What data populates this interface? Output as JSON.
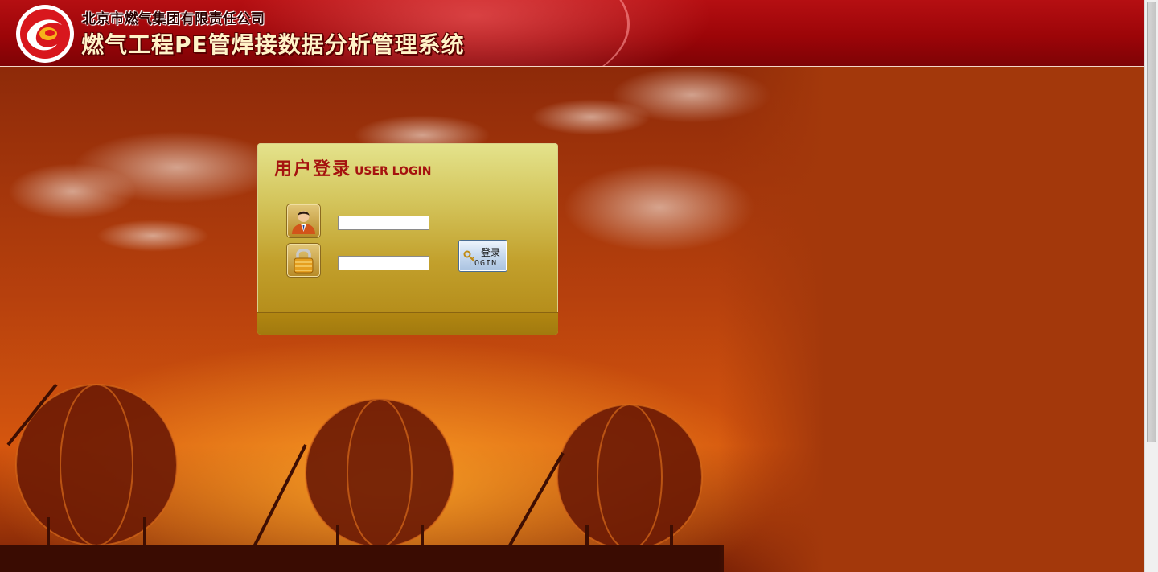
{
  "header": {
    "company_name": "北京市燃气集团有限责任公司",
    "system_title": "燃气工程PE管焊接数据分析管理系统",
    "logo_icon": "gas-group-logo",
    "brand_color": "#a10609"
  },
  "login": {
    "heading_cn": "用户登录",
    "heading_en": "USER LOGIN",
    "username_icon": "user-avatar-icon",
    "password_icon": "padlock-icon",
    "username_value": "",
    "password_value": "",
    "button_cn": "登录",
    "button_en": "LOGIN",
    "button_icon": "key-icon",
    "panel_color": "#c9ad3c",
    "heading_color": "#a5130f"
  },
  "background": {
    "scene": "gas-storage-spheres-at-sunset",
    "base_color": "#a3360b"
  }
}
